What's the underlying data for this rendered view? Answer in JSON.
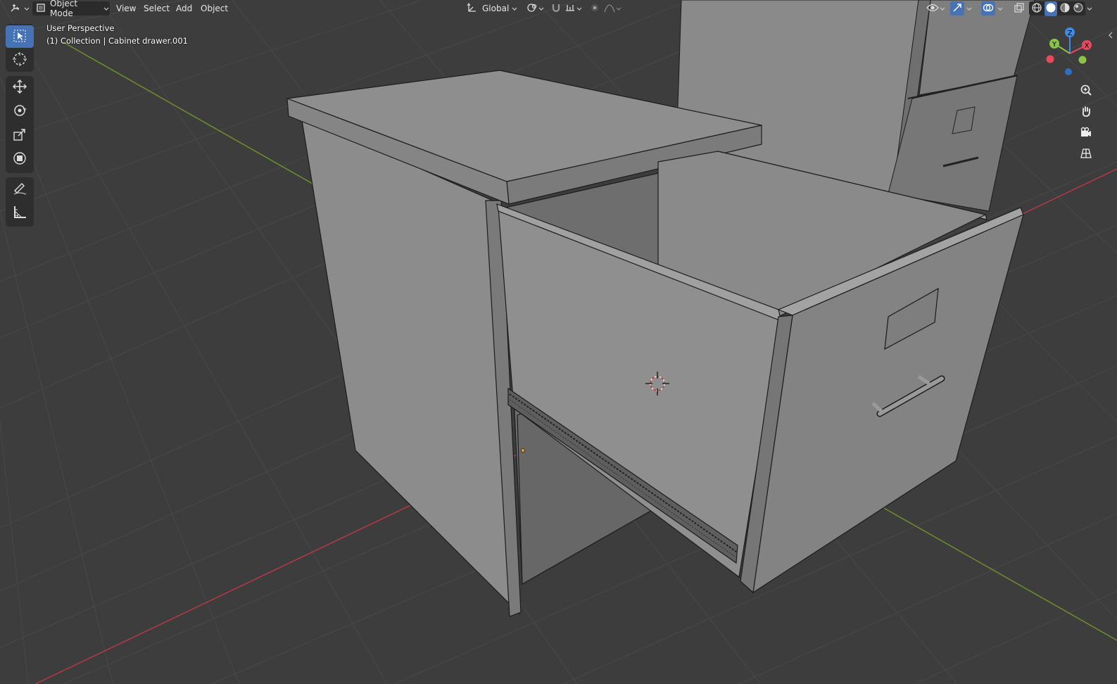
{
  "header": {
    "editor_type_icon": "view3d-editor-icon",
    "mode_label": "Object Mode",
    "menus": [
      "View",
      "Select",
      "Add",
      "Object"
    ],
    "transform_orientation": "Global",
    "pivot_icon": "pivot-icon",
    "snap_icon": "snap-magnet-icon",
    "proportional_icon": "proportional-edit-icon",
    "visibility_icon": "eye-icon",
    "gizmo_icon": "gizmo-icon",
    "overlay_icon": "overlay-icon",
    "xray_icon": "xray-icon",
    "shading_modes": [
      "wireframe",
      "solid",
      "material",
      "rendered"
    ],
    "active_shading": "solid"
  },
  "viewport": {
    "view_name": "User Perspective",
    "collection_info": "(1) Collection | Cabinet drawer.001",
    "background_color": "#3d3d3d",
    "grid_color": "#474747",
    "x_axis_color": "#b23a48",
    "y_axis_color": "#6e8f2a"
  },
  "toolbar": {
    "tools": [
      "select-box",
      "cursor",
      "move",
      "rotate",
      "scale",
      "transform",
      "annotate",
      "measure"
    ],
    "active_tool": "select-box"
  },
  "navigation": {
    "gizmo_axes": [
      "X",
      "Y",
      "Z"
    ],
    "axis_colors": {
      "x": "#e84a5f",
      "y": "#8bc34a",
      "z": "#3d8de8"
    },
    "buttons": [
      "zoom-icon",
      "pan-hand-icon",
      "camera-icon",
      "ortho-grid-icon"
    ]
  }
}
